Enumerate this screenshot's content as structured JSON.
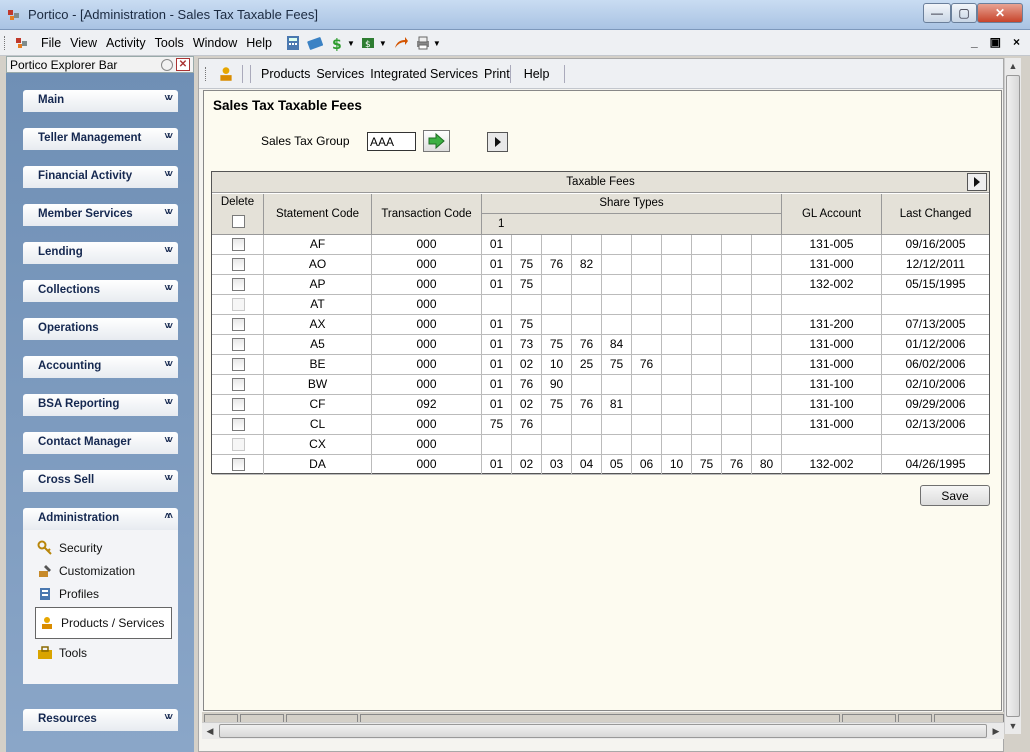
{
  "window": {
    "title": "Portico - [Administration - Sales Tax Taxable Fees]",
    "minimize": "—",
    "maximize": "▢",
    "close": "✕"
  },
  "menubar": {
    "items": [
      "File",
      "View",
      "Activity",
      "Tools",
      "Window",
      "Help"
    ],
    "mdi_min": "_",
    "mdi_restore": "▣",
    "mdi_close": "×"
  },
  "explorer": {
    "title": "Portico Explorer Bar",
    "groups": [
      {
        "label": "Main"
      },
      {
        "label": "Teller Management"
      },
      {
        "label": "Financial Activity"
      },
      {
        "label": "Member Services"
      },
      {
        "label": "Lending"
      },
      {
        "label": "Collections"
      },
      {
        "label": "Operations"
      },
      {
        "label": "Accounting"
      },
      {
        "label": "BSA Reporting"
      },
      {
        "label": "Contact Manager"
      },
      {
        "label": "Cross Sell"
      },
      {
        "label": "Administration"
      },
      {
        "label": "Resources"
      }
    ],
    "admin_items": [
      "Security",
      "Customization",
      "Profiles",
      "Products / Services",
      "Tools"
    ]
  },
  "content_toolbar": {
    "items": [
      "Products",
      "Services",
      "Integrated Services",
      "Print",
      "Help"
    ]
  },
  "page": {
    "title": "Sales Tax Taxable Fees",
    "sales_tax_group_label": "Sales Tax Group",
    "sales_tax_group_value": "AAA"
  },
  "grid": {
    "caption": "Taxable Fees",
    "headers": {
      "delete": "Delete",
      "statement_code": "Statement Code",
      "transaction_code": "Transaction Code",
      "share_types": "Share Types",
      "share_sub": "1",
      "gl_account": "GL Account",
      "last_changed": "Last Changed"
    },
    "rows": [
      {
        "code": "AF",
        "trans": "000",
        "shares": [
          "01",
          "",
          "",
          "",
          "",
          "",
          "",
          "",
          "",
          ""
        ],
        "gl": "131-005",
        "changed": "09/16/2005",
        "enabled": true
      },
      {
        "code": "AO",
        "trans": "000",
        "shares": [
          "01",
          "75",
          "76",
          "82",
          "",
          "",
          "",
          "",
          "",
          ""
        ],
        "gl": "131-000",
        "changed": "12/12/2011",
        "enabled": true
      },
      {
        "code": "AP",
        "trans": "000",
        "shares": [
          "01",
          "75",
          "",
          "",
          "",
          "",
          "",
          "",
          "",
          ""
        ],
        "gl": "132-002",
        "changed": "05/15/1995",
        "enabled": true
      },
      {
        "code": "AT",
        "trans": "000",
        "shares": [
          "",
          "",
          "",
          "",
          "",
          "",
          "",
          "",
          "",
          ""
        ],
        "gl": "",
        "changed": "",
        "enabled": false
      },
      {
        "code": "AX",
        "trans": "000",
        "shares": [
          "01",
          "75",
          "",
          "",
          "",
          "",
          "",
          "",
          "",
          ""
        ],
        "gl": "131-200",
        "changed": "07/13/2005",
        "enabled": true
      },
      {
        "code": "A5",
        "trans": "000",
        "shares": [
          "01",
          "73",
          "75",
          "76",
          "84",
          "",
          "",
          "",
          "",
          ""
        ],
        "gl": "131-000",
        "changed": "01/12/2006",
        "enabled": true
      },
      {
        "code": "BE",
        "trans": "000",
        "shares": [
          "01",
          "02",
          "10",
          "25",
          "75",
          "76",
          "",
          "",
          "",
          ""
        ],
        "gl": "131-000",
        "changed": "06/02/2006",
        "enabled": true
      },
      {
        "code": "BW",
        "trans": "000",
        "shares": [
          "01",
          "76",
          "90",
          "",
          "",
          "",
          "",
          "",
          "",
          ""
        ],
        "gl": "131-100",
        "changed": "02/10/2006",
        "enabled": true
      },
      {
        "code": "CF",
        "trans": "092",
        "shares": [
          "01",
          "02",
          "75",
          "76",
          "81",
          "",
          "",
          "",
          "",
          ""
        ],
        "gl": "131-100",
        "changed": "09/29/2006",
        "enabled": true
      },
      {
        "code": "CL",
        "trans": "000",
        "shares": [
          "75",
          "76",
          "",
          "",
          "",
          "",
          "",
          "",
          "",
          ""
        ],
        "gl": "131-000",
        "changed": "02/13/2006",
        "enabled": true
      },
      {
        "code": "CX",
        "trans": "000",
        "shares": [
          "",
          "",
          "",
          "",
          "",
          "",
          "",
          "",
          "",
          ""
        ],
        "gl": "",
        "changed": "",
        "enabled": false
      },
      {
        "code": "DA",
        "trans": "000",
        "shares": [
          "01",
          "02",
          "03",
          "04",
          "05",
          "06",
          "10",
          "75",
          "76",
          "80"
        ],
        "gl": "132-002",
        "changed": "04/26/1995",
        "enabled": true
      }
    ]
  },
  "save_label": "Save",
  "colors": {
    "explorer_bg": "#7f9db9",
    "page_bg": "#fdfbf0",
    "header_bg": "#e4e1d8",
    "go_arrow": "#2e9c2e"
  }
}
